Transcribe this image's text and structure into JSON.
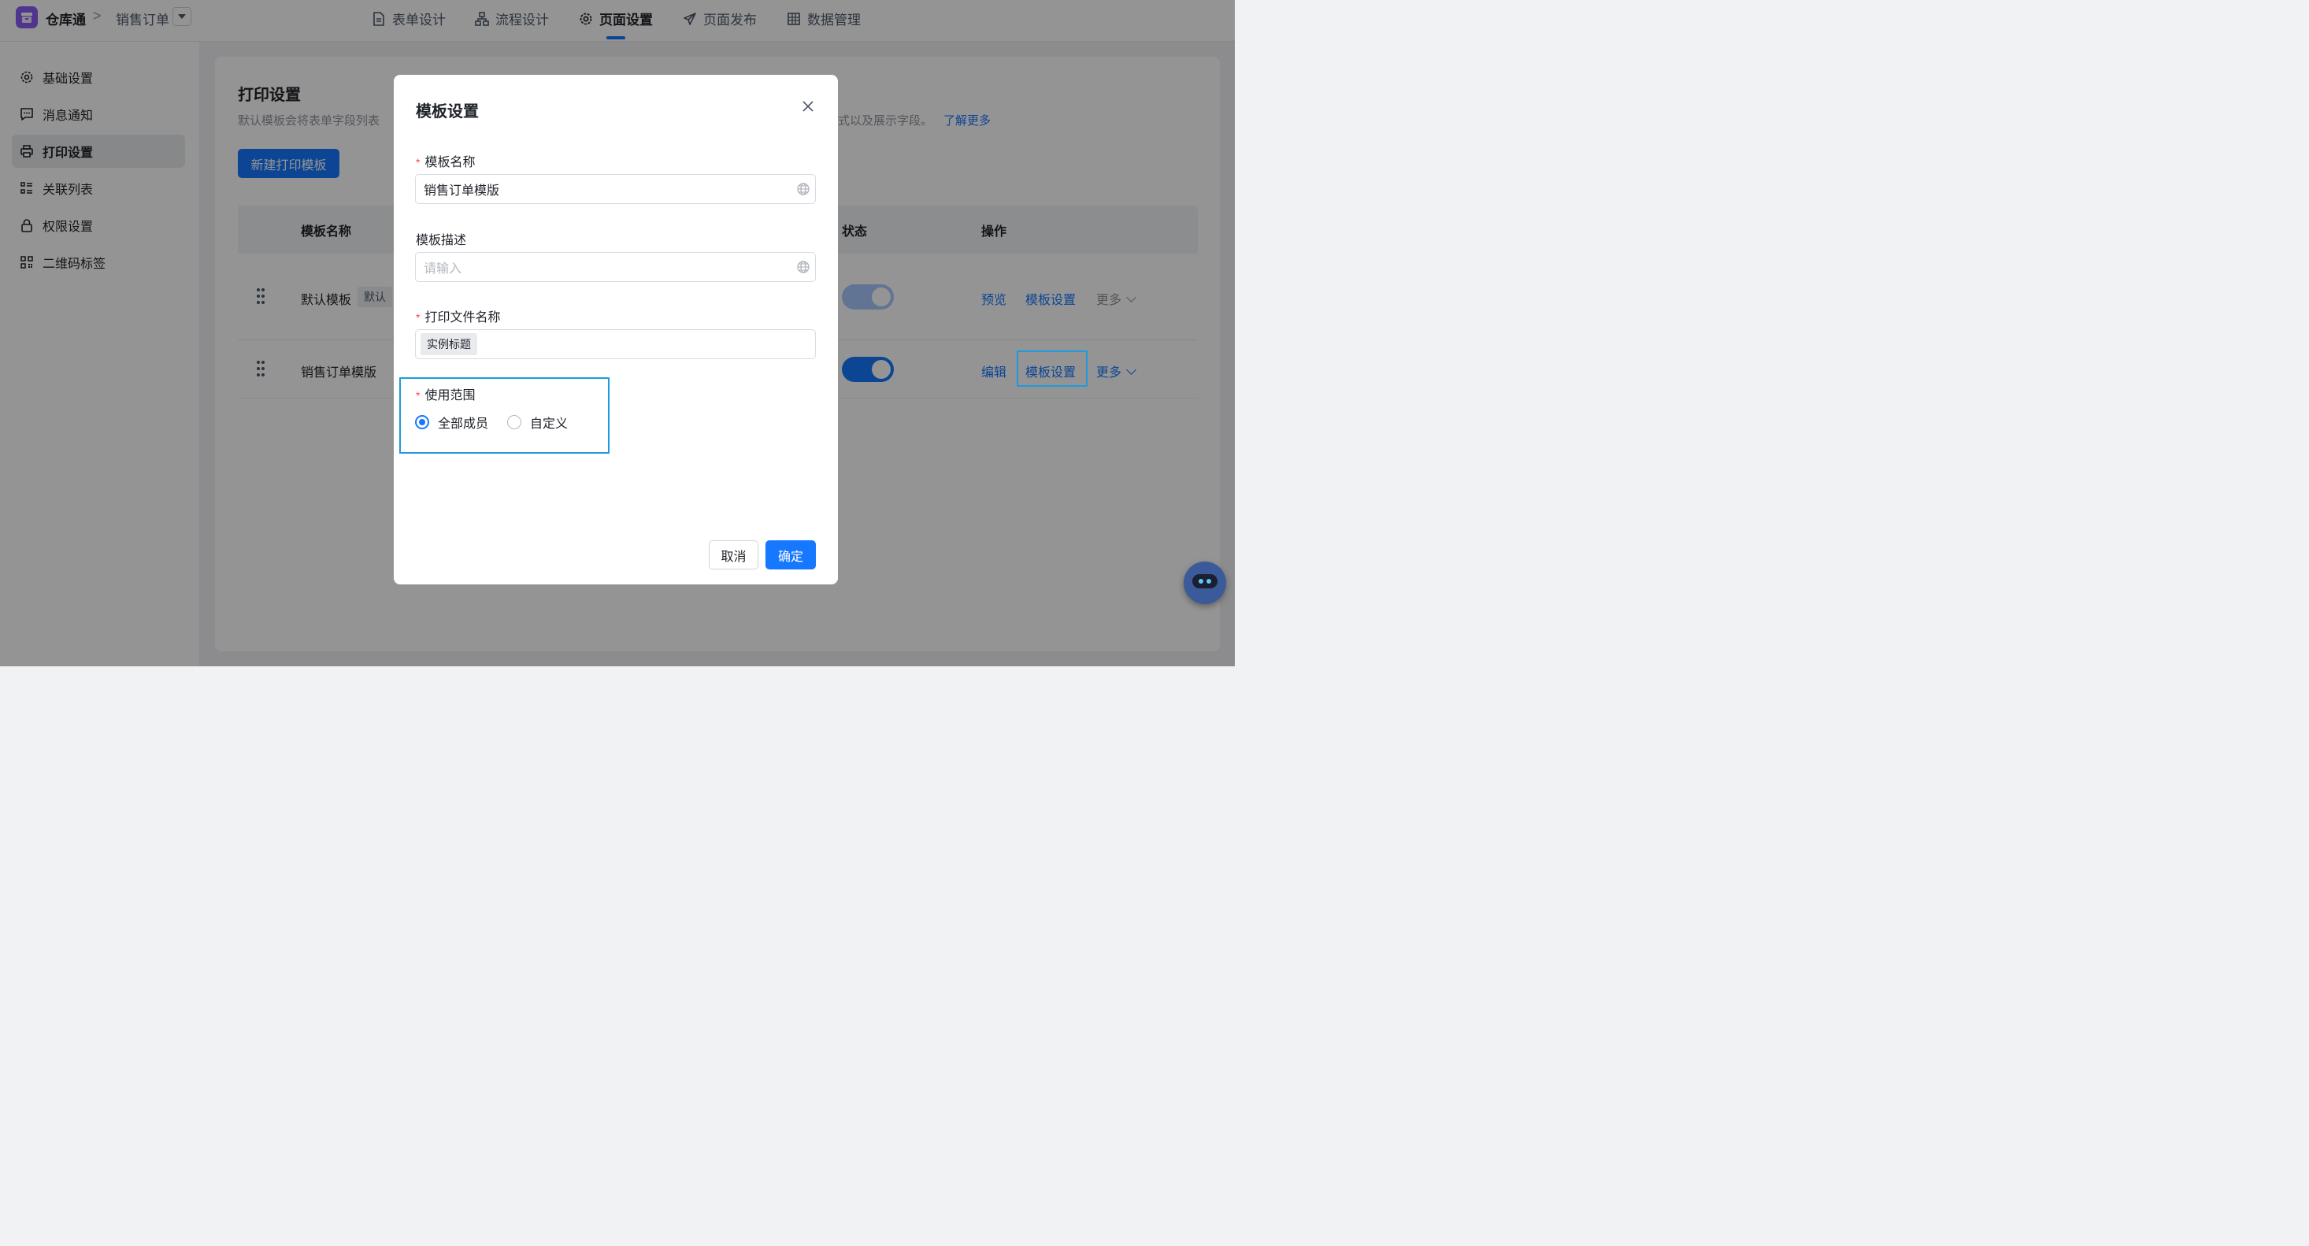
{
  "header": {
    "app_name": "仓库通",
    "breadcrumb_sep": ">",
    "page_name": "销售订单",
    "nav": [
      {
        "label": "表单设计",
        "icon": "document-icon",
        "active": false
      },
      {
        "label": "流程设计",
        "icon": "flow-icon",
        "active": false
      },
      {
        "label": "页面设置",
        "icon": "gear-icon",
        "active": true
      },
      {
        "label": "页面发布",
        "icon": "send-icon",
        "active": false
      },
      {
        "label": "数据管理",
        "icon": "table-icon",
        "active": false
      }
    ]
  },
  "sidebar": {
    "items": [
      {
        "label": "基础设置",
        "icon": "gear-icon",
        "active": false
      },
      {
        "label": "消息通知",
        "icon": "message-icon",
        "active": false
      },
      {
        "label": "打印设置",
        "icon": "printer-icon",
        "active": true
      },
      {
        "label": "关联列表",
        "icon": "list-icon",
        "active": false
      },
      {
        "label": "权限设置",
        "icon": "lock-icon",
        "active": false
      },
      {
        "label": "二维码标签",
        "icon": "qrcode-icon",
        "active": false
      }
    ]
  },
  "print_settings": {
    "title": "打印设置",
    "desc_visible_start": "默认模板会将表单字段列表",
    "desc_visible_end": "式以及展示字段。",
    "learn_more": "了解更多",
    "new_button": "新建打印模板",
    "columns": {
      "name": "模板名称",
      "status": "状态",
      "actions": "操作"
    },
    "rows": [
      {
        "name": "默认模板",
        "tag": "默认",
        "enabled": true,
        "actions": [
          "预览",
          "模板设置",
          "更多"
        ]
      },
      {
        "name": "销售订单模版",
        "tag": "",
        "enabled": true,
        "actions": [
          "编辑",
          "模板设置",
          "更多"
        ]
      }
    ]
  },
  "modal": {
    "title": "模板设置",
    "fields": {
      "name": {
        "label": "模板名称",
        "required": true,
        "value": "销售订单模版"
      },
      "description": {
        "label": "模板描述",
        "required": false,
        "value": "",
        "placeholder": "请输入"
      },
      "file_name": {
        "label": "打印文件名称",
        "required": true,
        "chip": "实例标题"
      },
      "scope": {
        "label": "使用范围",
        "required": true,
        "options": [
          "全部成员",
          "自定义"
        ],
        "selected": "全部成员"
      }
    },
    "cancel": "取消",
    "confirm": "确定"
  },
  "colors": {
    "accent": "#1677ff",
    "highlight": "#1e9ae0",
    "required": "#f54a45"
  }
}
